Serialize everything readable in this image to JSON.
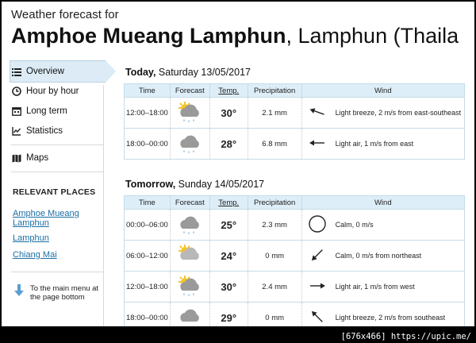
{
  "header": {
    "subtitle": "Weather forecast for",
    "location_bold": "Amphoe Mueang Lamphun",
    "location_rest": ", Lamphun (Thaila"
  },
  "sidebar": {
    "items": [
      {
        "label": "Overview",
        "icon": "list-icon"
      },
      {
        "label": "Hour by hour",
        "icon": "clock-icon"
      },
      {
        "label": "Long term",
        "icon": "calendar-icon"
      },
      {
        "label": "Statistics",
        "icon": "chart-icon"
      },
      {
        "label": "Maps",
        "icon": "map-icon"
      }
    ],
    "relevant_heading": "RELEVANT PLACES",
    "places": [
      "Amphoe Mueang Lamphun",
      "Lamphun",
      "Chiang Mai"
    ],
    "to_main": "To the main menu at the page bottom"
  },
  "columns": {
    "time": "Time",
    "forecast": "Forecast",
    "temp": "Temp.",
    "precip": "Precipitation",
    "wind": "Wind"
  },
  "days": [
    {
      "label": "Today,",
      "date": " Saturday 13/05/2017",
      "rows": [
        {
          "time": "12:00–18:00",
          "icon": "sun-cloud-rain",
          "temp": "30°",
          "precip": "2.1 mm",
          "wind": "Light breeze, 2 m/s from east-southeast",
          "arrow": 290
        },
        {
          "time": "18:00–00:00",
          "icon": "cloud-rain",
          "temp": "28°",
          "precip": "6.8 mm",
          "wind": "Light air, 1 m/s from east",
          "arrow": 270
        }
      ]
    },
    {
      "label": "Tomorrow,",
      "date": " Sunday 14/05/2017",
      "rows": [
        {
          "time": "00:00–06:00",
          "icon": "cloud-rain",
          "temp": "25°",
          "precip": "2.3 mm",
          "wind": "Calm, 0 m/s",
          "arrow": -1
        },
        {
          "time": "06:00–12:00",
          "icon": "sun-cloud",
          "temp": "24°",
          "precip": "0 mm",
          "wind": "Calm, 0 m/s from northeast",
          "arrow": 225
        },
        {
          "time": "12:00–18:00",
          "icon": "sun-cloud-rain",
          "temp": "30°",
          "precip": "2.4 mm",
          "wind": "Light air, 1 m/s from west",
          "arrow": 90
        },
        {
          "time": "18:00–00:00",
          "icon": "cloud",
          "temp": "29°",
          "precip": "0 mm",
          "wind": "Light breeze, 2 m/s from southeast",
          "arrow": 315
        }
      ]
    }
  ],
  "watermark": "[676x466] https://upic.me/",
  "colors": {
    "accent": "#1a6fa3",
    "temp": "#d0181e",
    "header_bg": "#ddeef8",
    "nav_active": "#dcebf5"
  }
}
